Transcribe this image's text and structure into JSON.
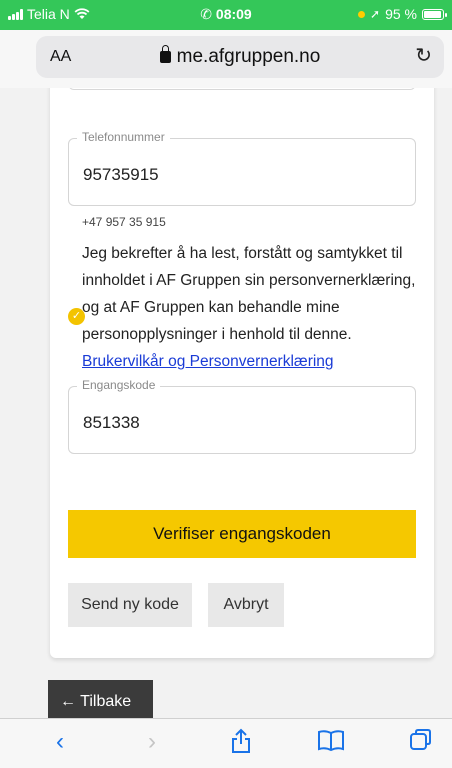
{
  "status_bar": {
    "carrier": "Telia N",
    "time": "08:09",
    "battery": "95 %",
    "battery_level": 0.95,
    "call_color": "#34c759"
  },
  "browser": {
    "text_size_label": "AA",
    "url": "me.afgruppen.no",
    "icons": [
      "lock-icon",
      "reload-icon",
      "back-icon",
      "forward-icon",
      "share-icon",
      "bookmarks-icon",
      "tabs-icon"
    ]
  },
  "form": {
    "phone": {
      "label": "Telefonnummer",
      "value": "95735915",
      "formatted": "+47 957 35 915"
    },
    "consent": {
      "text": "Jeg bekrefter å ha lest, forstått og samtykket til innholdet i AF Gruppen sin personvernerklæring, og at AF Gruppen kan behandle mine personopplysninger i henhold til denne.",
      "link_text": "Brukervilkår og Personvernerklæring",
      "checked": true
    },
    "code": {
      "label": "Engangskode",
      "value": "851338"
    },
    "verify_button": "Verifiser engangskoden",
    "resend_button": "Send ny kode",
    "cancel_button": "Avbryt"
  },
  "back_button": "← Tilbake",
  "colors": {
    "accent": "#f5c800",
    "link": "#1a3bd6",
    "back_button_bg": "#3b3b3b"
  }
}
